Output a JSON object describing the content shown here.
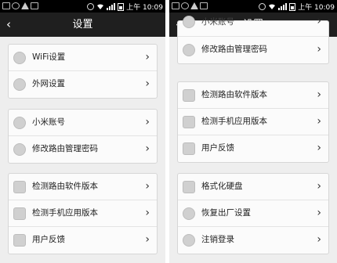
{
  "screens": [
    {
      "status_time": "上午 10:09",
      "title": "设置",
      "back_glyph": "‹",
      "chevron_glyph": "›",
      "groups": [
        {
          "items": [
            {
              "label": "WiFi设置",
              "icon": "wifi-icon"
            },
            {
              "label": "外网设置",
              "icon": "globe-icon"
            }
          ]
        },
        {
          "items": [
            {
              "label": "小米账号",
              "icon": "mi-account-icon"
            },
            {
              "label": "修改路由管理密码",
              "icon": "lock-icon"
            }
          ]
        },
        {
          "items": [
            {
              "label": "检测路由软件版本",
              "icon": "router-icon"
            },
            {
              "label": "检测手机应用版本",
              "icon": "phone-icon"
            },
            {
              "label": "用户反馈",
              "icon": "feedback-icon"
            }
          ]
        }
      ]
    },
    {
      "status_time": "上午 10:09",
      "title": "设置",
      "back_glyph": "‹",
      "chevron_glyph": "›",
      "groups": [
        {
          "items": [
            {
              "label": "小米账号",
              "icon": "mi-account-icon"
            },
            {
              "label": "修改路由管理密码",
              "icon": "lock-icon"
            }
          ]
        },
        {
          "items": [
            {
              "label": "检测路由软件版本",
              "icon": "router-icon"
            },
            {
              "label": "检测手机应用版本",
              "icon": "phone-icon"
            },
            {
              "label": "用户反馈",
              "icon": "feedback-icon"
            }
          ]
        },
        {
          "items": [
            {
              "label": "格式化硬盘",
              "icon": "disk-icon"
            },
            {
              "label": "恢复出厂设置",
              "icon": "reset-icon"
            },
            {
              "label": "注销登录",
              "icon": "logout-icon"
            }
          ]
        }
      ]
    }
  ]
}
